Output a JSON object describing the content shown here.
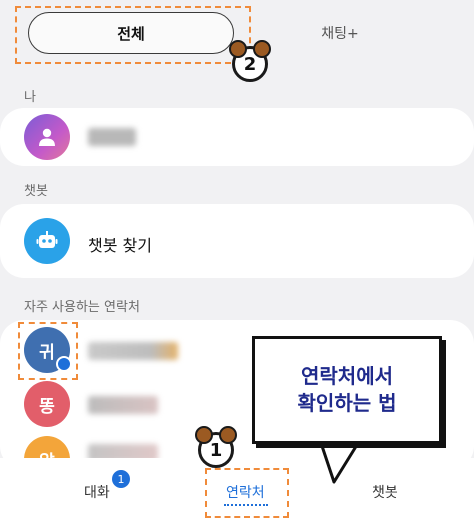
{
  "tabs": {
    "all": "전체",
    "chatting_plus": "채팅+"
  },
  "sections": {
    "me": "나",
    "chatbot": "챗봇",
    "frequent_contacts": "자주 사용하는 연락처"
  },
  "chatbot_row": {
    "label": "챗봇 찾기"
  },
  "contacts": [
    {
      "avatar_text": "귀",
      "avatar_color": "#3f6fb0"
    },
    {
      "avatar_text": "똥",
      "avatar_color": "#e25e6a"
    },
    {
      "avatar_text": "알",
      "avatar_color": "#f3a53a"
    }
  ],
  "bottom_nav": {
    "conversations": "대화",
    "conversations_badge": "1",
    "contacts": "연락처",
    "chatbot": "챗봇"
  },
  "annotations": {
    "step1": "1",
    "step2": "2",
    "callout_line1": "연락처에서",
    "callout_line2": "확인하는 법"
  },
  "colors": {
    "accent": "#1e6fd9",
    "annotation_border": "#f08b3a",
    "callout_text": "#1f2a8c"
  }
}
